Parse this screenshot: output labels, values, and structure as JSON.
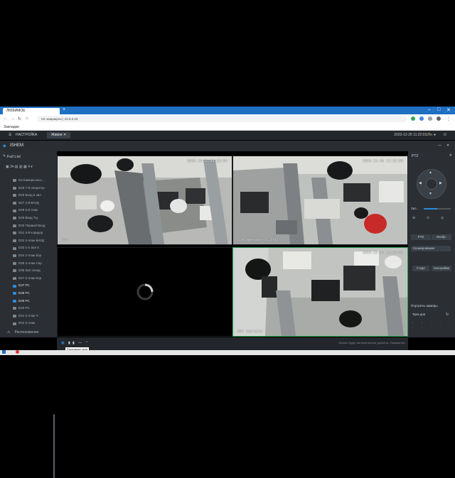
{
  "browser": {
    "tab_title": "ЛЮБИМОЕ",
    "new_tab": "+",
    "url": "Не защищено | 10.0.0.23",
    "bookmarks": "Закладки",
    "controls": {
      "minimize": "–",
      "maximize": "□",
      "close": "✕"
    }
  },
  "app": {
    "menu_tabs": [
      "НАСТРОЙКА",
      "Живое"
    ],
    "datetime": "2023-12-25 11:22:01 Пн",
    "name": "ISHEM",
    "device_list_title": "Full List",
    "left_toolbar": "▣ 3▾ ▤ ▥ ▦ 4 ▾",
    "tree": [
      {
        "label": "D4 Камера касс...",
        "active": false
      },
      {
        "label": "D25 7-й оператор",
        "active": false
      },
      {
        "label": "D26 Вход в зал",
        "active": false
      },
      {
        "label": "D27 2-й ВАУД",
        "active": false
      },
      {
        "label": "D28 5-й этаж",
        "active": false
      },
      {
        "label": "D29 Вход ТЦ",
        "active": false
      },
      {
        "label": "D30 Первый Вход",
        "active": false
      },
      {
        "label": "D31 3-й коридор",
        "active": false
      },
      {
        "label": "D32 2-этаж ВАУД",
        "active": false
      },
      {
        "label": "D33 1-е Зал 5",
        "active": false
      },
      {
        "label": "D34 2-этаж Кор",
        "active": false
      },
      {
        "label": "D35 2-этаж Сер",
        "active": false
      },
      {
        "label": "D36 Зал склад",
        "active": false
      },
      {
        "label": "D37 2-этаж Кор",
        "active": false
      },
      {
        "label": "D37 PC",
        "active": true
      },
      {
        "label": "D38 PC",
        "active": true
      },
      {
        "label": "D39 PC",
        "active": true
      },
      {
        "label": "D40 PC",
        "active": false
      },
      {
        "label": "D41 2-этаж Ч",
        "active": false
      },
      {
        "label": "D42 2-этаж",
        "active": false
      }
    ],
    "left_footer": "Расположение",
    "right_title": "PTZ",
    "zoom_label": "Зат...",
    "right_tabs": [
      "PTZ",
      "Изобр."
    ],
    "preset_select": "Сканирование",
    "preset_buttons": [
      "Старт",
      "Настройки"
    ],
    "right_section": "Портреты камеры",
    "right_sub": "Трек дня",
    "bottom_tooltip": "Раскладка окна",
    "bottom_status": "Записи будут автоматически удалены. Параметры"
  },
  "cameras": [
    {
      "id": "cam1",
      "osd_time": "2023-12-25 11:22:01",
      "label": "D38"
    },
    {
      "id": "cam2",
      "osd_time": "2023-12-25 11:22:00",
      "label": "D39 operator 1 2nd"
    },
    {
      "id": "cam3",
      "osd_time": "",
      "label": ""
    },
    {
      "id": "cam4",
      "osd_time": "2023-12-25 11:22:00",
      "label": "D37 Operator 1"
    }
  ]
}
